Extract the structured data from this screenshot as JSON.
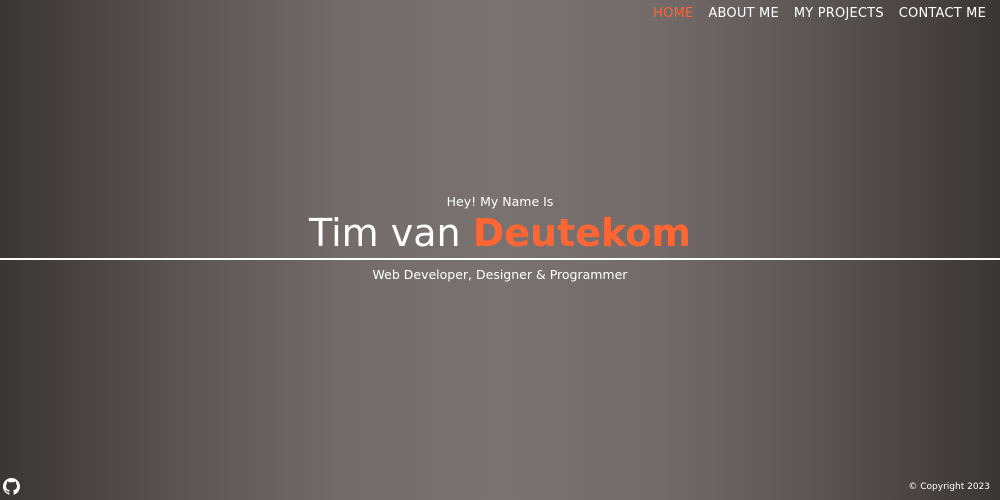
{
  "nav": {
    "items": [
      {
        "label": "HOME",
        "active": true
      },
      {
        "label": "ABOUT ME",
        "active": false
      },
      {
        "label": "MY PROJECTS",
        "active": false
      },
      {
        "label": "CONTACT ME",
        "active": false
      }
    ]
  },
  "hero": {
    "greeting": "Hey! My Name Is",
    "first_name": "Tim van",
    "last_name": "Deutekom",
    "tagline": "Web Developer, Designer & Programmer"
  },
  "footer": {
    "icon": "github-icon",
    "copyright": "© Copyright 2023"
  },
  "colors": {
    "accent": "#ff6633",
    "text": "#ffffff",
    "bg_edge": "#3a3636",
    "bg_center": "#7a7270"
  }
}
